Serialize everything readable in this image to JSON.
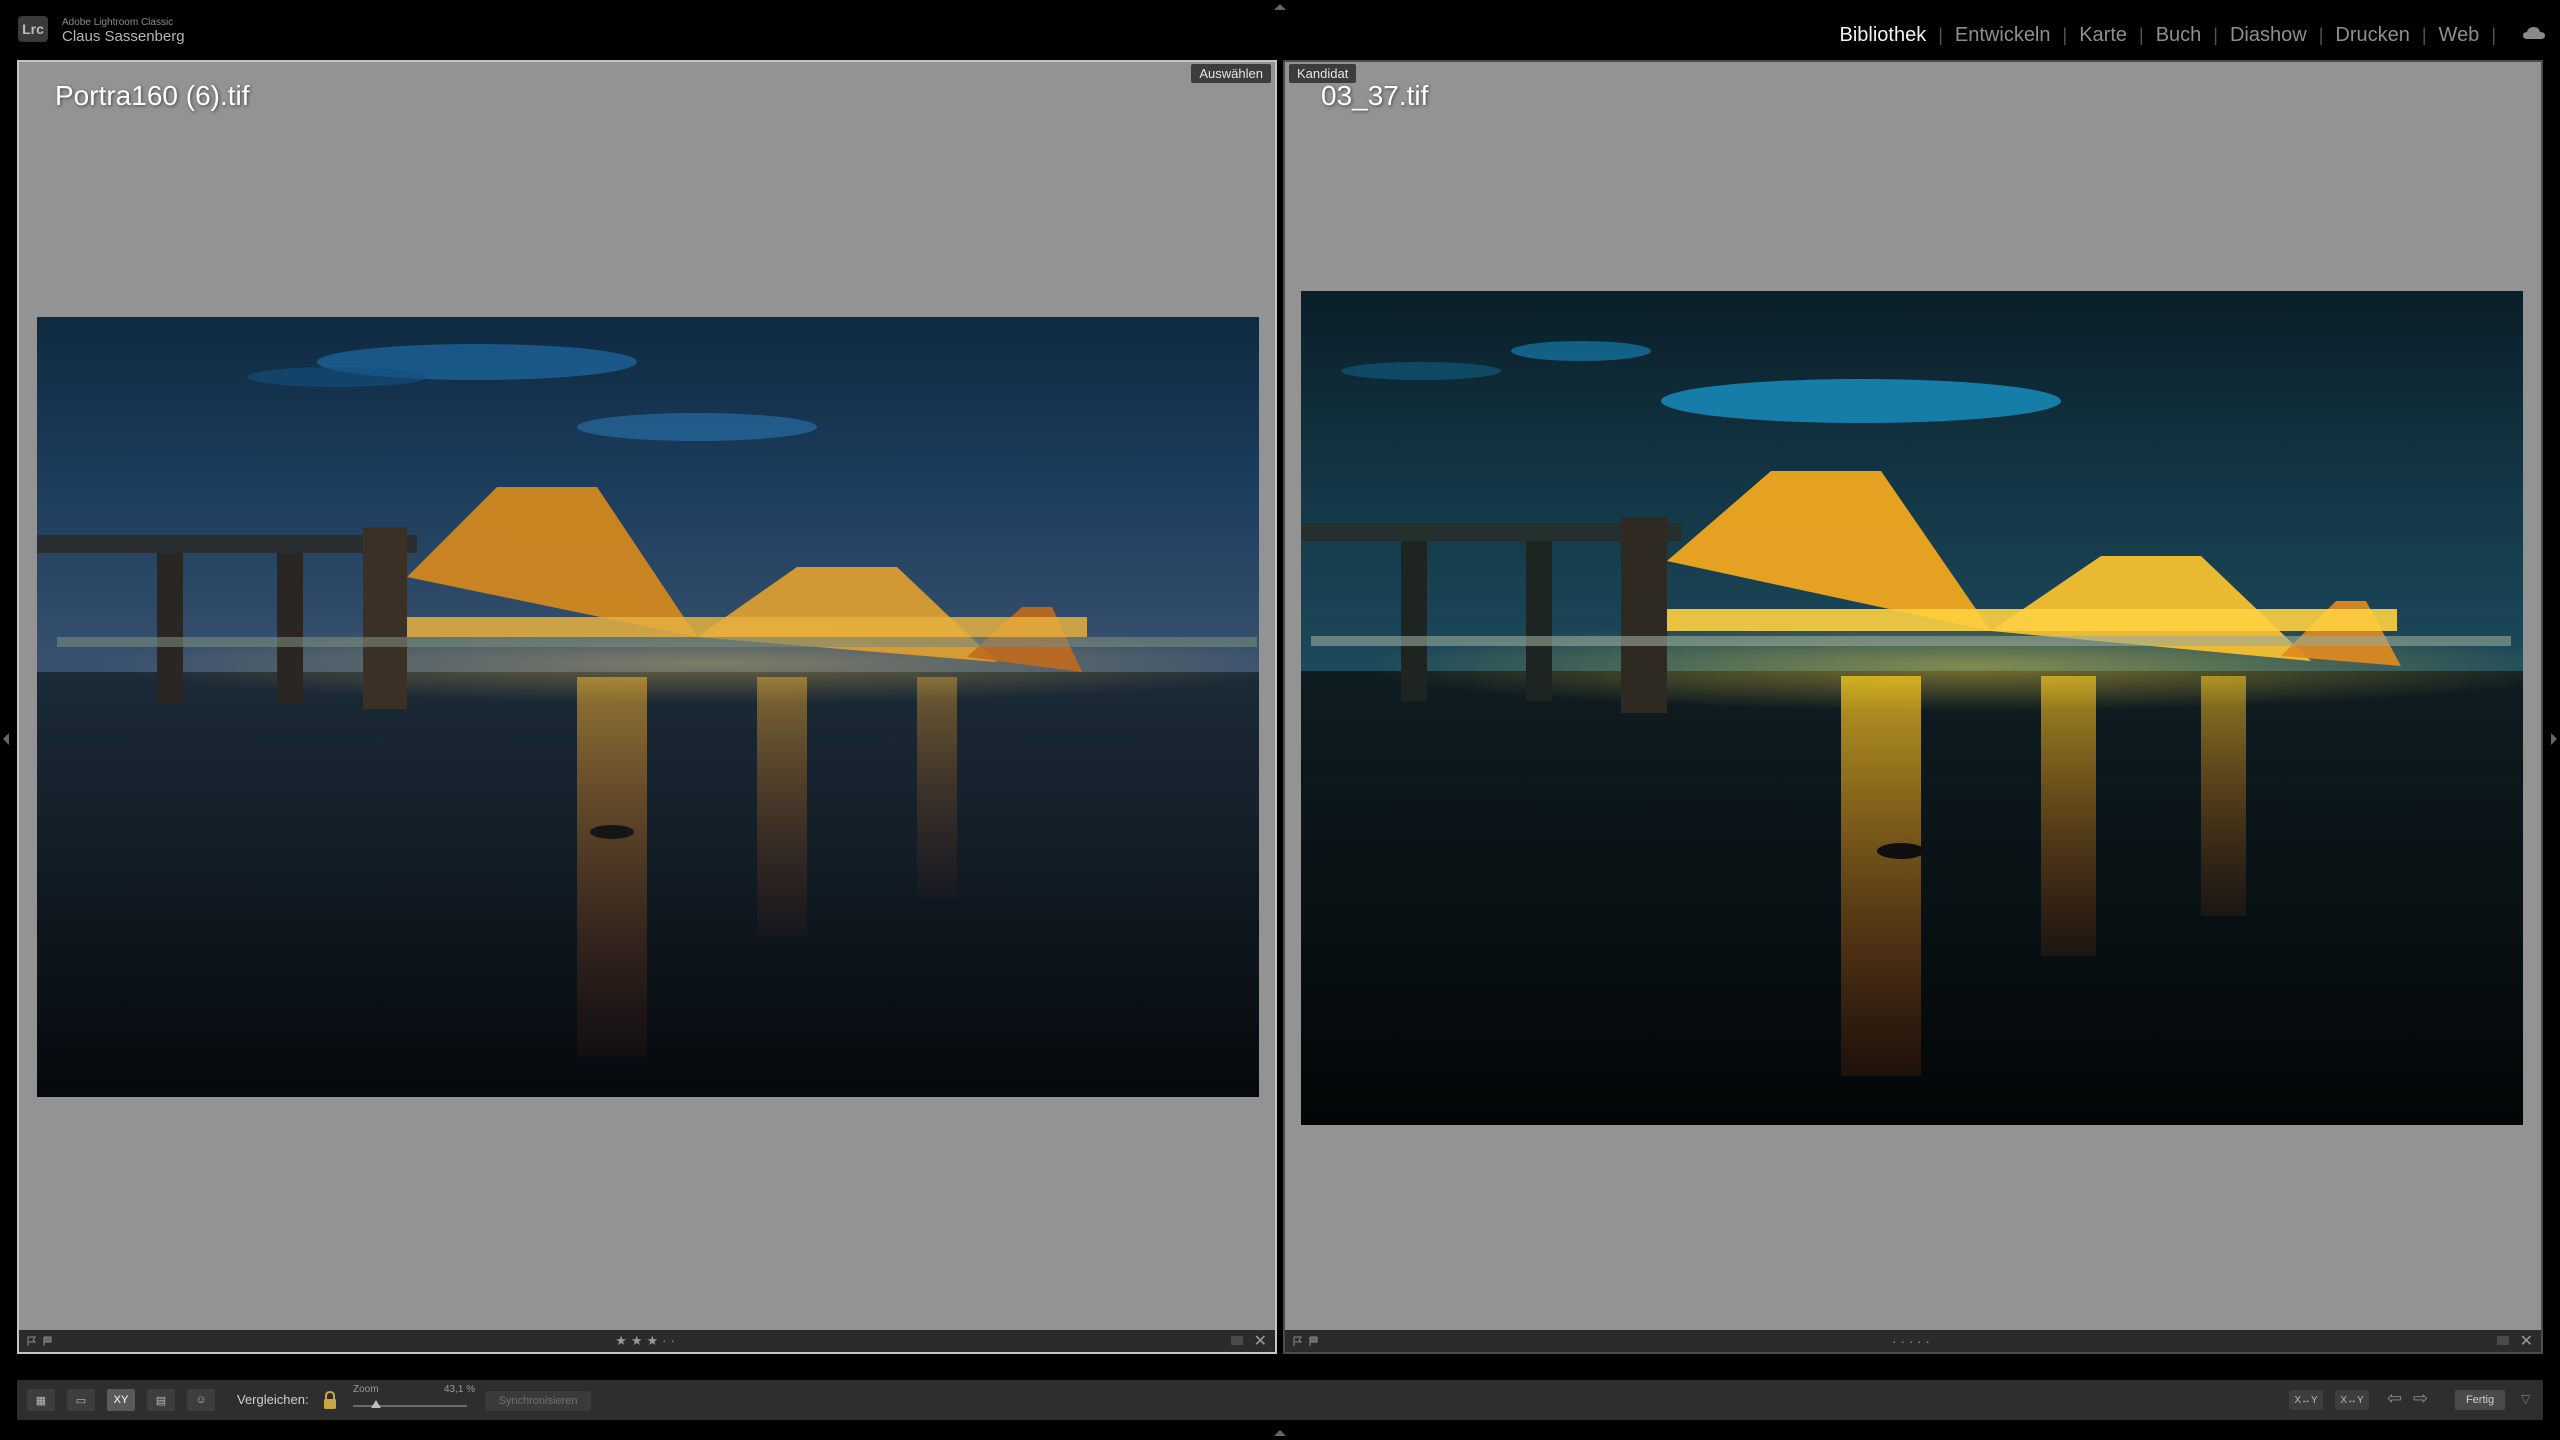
{
  "app": {
    "logo": "Lrc",
    "name": "Adobe Lightroom Classic",
    "user": "Claus Sassenberg"
  },
  "modules": [
    {
      "label": "Bibliothek",
      "active": true
    },
    {
      "label": "Entwickeln",
      "active": false
    },
    {
      "label": "Karte",
      "active": false
    },
    {
      "label": "Buch",
      "active": false
    },
    {
      "label": "Diashow",
      "active": false
    },
    {
      "label": "Drucken",
      "active": false
    },
    {
      "label": "Web",
      "active": false
    }
  ],
  "module_separator": "|",
  "compare": {
    "left": {
      "badge": "Auswählen",
      "filename": "Portra160 (6).tif",
      "rating": "★★★··"
    },
    "right": {
      "badge": "Kandidat",
      "filename": "03_37.tif",
      "rating": "·····"
    }
  },
  "toolbar": {
    "compare_label": "Vergleichen:",
    "zoom_label": "Zoom",
    "zoom_value": "43,1 %",
    "zoom_fraction": 0.2,
    "sync_label": "Synchronisieren",
    "swap_label": "X↔Y",
    "make_select_label": "X↔Y",
    "done_label": "Fertig",
    "view_modes": [
      {
        "name": "grid-view-icon",
        "label": "▦",
        "selected": false
      },
      {
        "name": "loupe-view-icon",
        "label": "▭",
        "selected": false
      },
      {
        "name": "compare-view-icon",
        "label": "XY",
        "selected": true
      },
      {
        "name": "survey-view-icon",
        "label": "▤",
        "selected": false
      },
      {
        "name": "people-view-icon",
        "label": "☺",
        "selected": false
      }
    ]
  },
  "icons": {
    "cloud": "cloud-sync-icon",
    "lock": "lock-icon",
    "flag": "flag-icon",
    "close": "✕",
    "prev": "⇦",
    "next": "⇨",
    "menu": "▽"
  },
  "colors": {
    "pane_bg": "#939393",
    "active_border": "#c4c4c4",
    "module_active": "#f2f2f2",
    "module_inactive": "#8e8e8e"
  }
}
